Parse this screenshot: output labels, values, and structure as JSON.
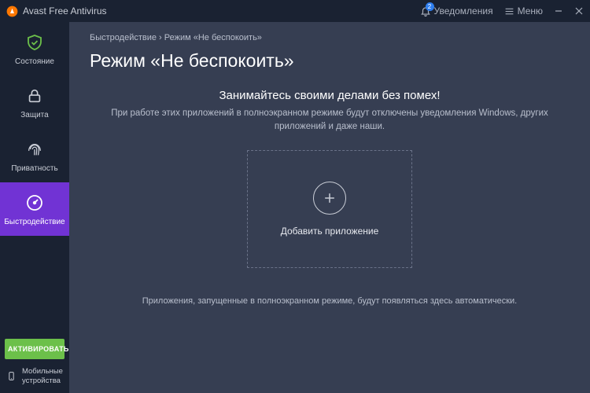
{
  "titlebar": {
    "app_name": "Avast Free Antivirus",
    "notifications_label": "Уведомления",
    "notifications_count": "2",
    "menu_label": "Меню"
  },
  "sidebar": {
    "items": [
      {
        "label": "Состояние"
      },
      {
        "label": "Защита"
      },
      {
        "label": "Приватность"
      },
      {
        "label": "Быстродействие"
      }
    ],
    "activate_label": "АКТИВИРОВАТЬ",
    "mobile_label": "Мобильные устройства"
  },
  "main": {
    "breadcrumb": "Быстродействие  ›  Режим «Не беспокоить»",
    "title": "Режим «Не беспокоить»",
    "headline": "Занимайтесь своими делами без помех!",
    "subtext": "При работе этих приложений в полноэкранном режиме будут отключены уведомления Windows, других приложений и даже наши.",
    "add_app_label": "Добавить приложение",
    "footer_note": "Приложения, запущенные в полноэкранном режиме, будут появляться здесь автоматически."
  }
}
